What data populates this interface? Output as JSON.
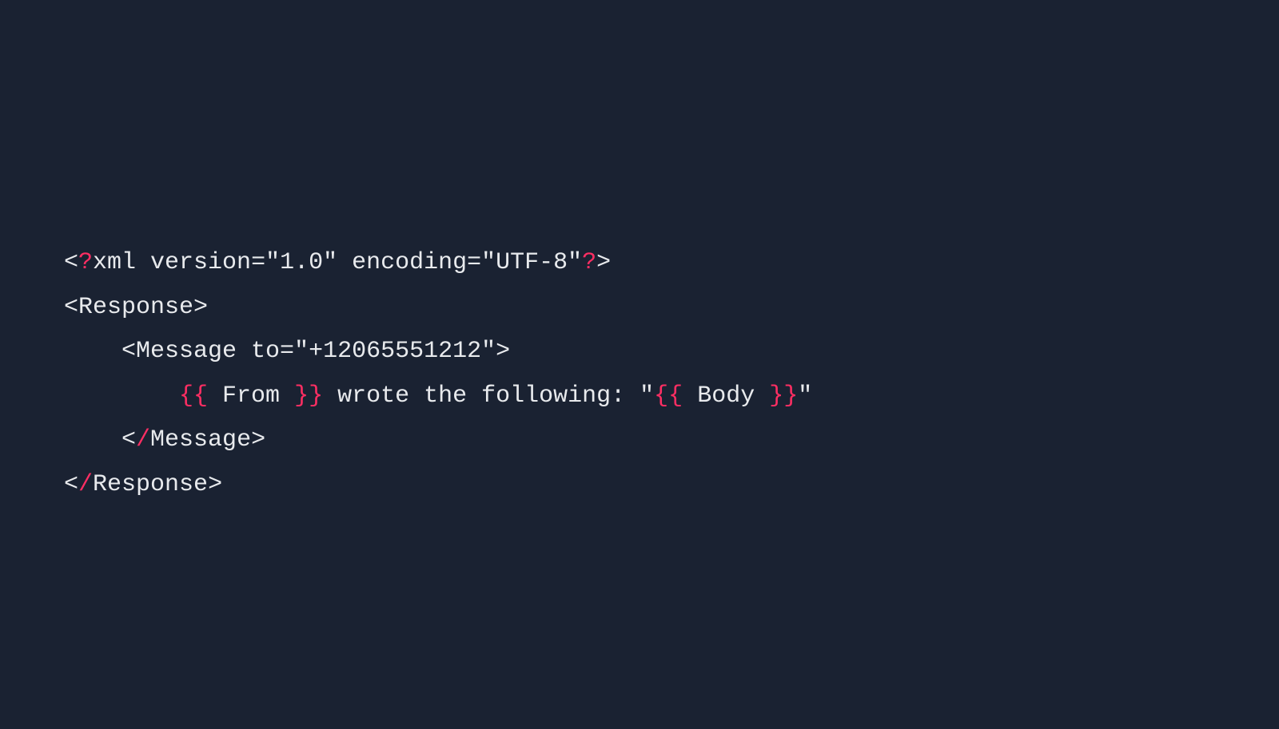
{
  "code": {
    "line1": {
      "lt": "<",
      "q1": "?",
      "decl": "xml version=\"1.0\" encoding=\"UTF-8\"",
      "q2": "?",
      "gt": ">"
    },
    "line2": {
      "lt": "<",
      "tag": "Response",
      "gt": ">"
    },
    "line3": {
      "indent": "    ",
      "lt": "<",
      "tag": "Message to=\"+12065551212\"",
      "gt": ">"
    },
    "line4": {
      "indent": "        ",
      "lcurly": "{{",
      "from": " From ",
      "rcurly": "}}",
      "mid": " wrote the following: \"",
      "lcurly2": "{{",
      "body": " Body ",
      "rcurly2": "}}",
      "end": "\""
    },
    "line5": {
      "indent": "    ",
      "lt": "<",
      "slash": "/",
      "tag": "Message",
      "gt": ">"
    },
    "line6": {
      "lt": "<",
      "slash": "/",
      "tag": "Response",
      "gt": ">"
    }
  }
}
